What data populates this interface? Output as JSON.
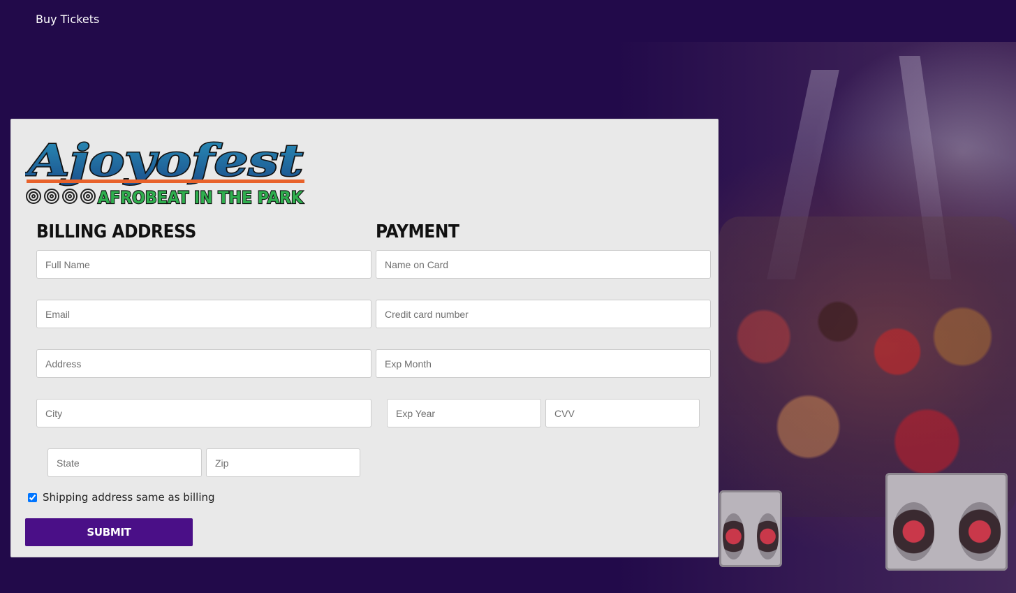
{
  "nav": {
    "buy_tickets": "Buy Tickets"
  },
  "logo": {
    "title": "Ajoyofest",
    "tagline": "AFROBEAT IN THE PARK"
  },
  "billing": {
    "title": "BILLING ADDRESS",
    "full_name_placeholder": "Full Name",
    "email_placeholder": "Email",
    "address_placeholder": "Address",
    "city_placeholder": "City",
    "state_placeholder": "State",
    "zip_placeholder": "Zip"
  },
  "payment": {
    "title": "PAYMENT",
    "name_on_card_placeholder": "Name on Card",
    "card_number_placeholder": "Credit card number",
    "exp_month_placeholder": "Exp Month",
    "exp_year_placeholder": "Exp Year",
    "cvv_placeholder": "CVV"
  },
  "shipping": {
    "same_as_billing_label": "Shipping address same as billing",
    "checked": true
  },
  "submit": {
    "label": "SUBMIT"
  },
  "colors": {
    "page_background": "#220a4a",
    "card_background": "#e9e9e9",
    "submit_button": "#4a0f87",
    "logo_blue": "#1f6fa8",
    "logo_green": "#2fae4e",
    "logo_orange": "#e8622b"
  }
}
